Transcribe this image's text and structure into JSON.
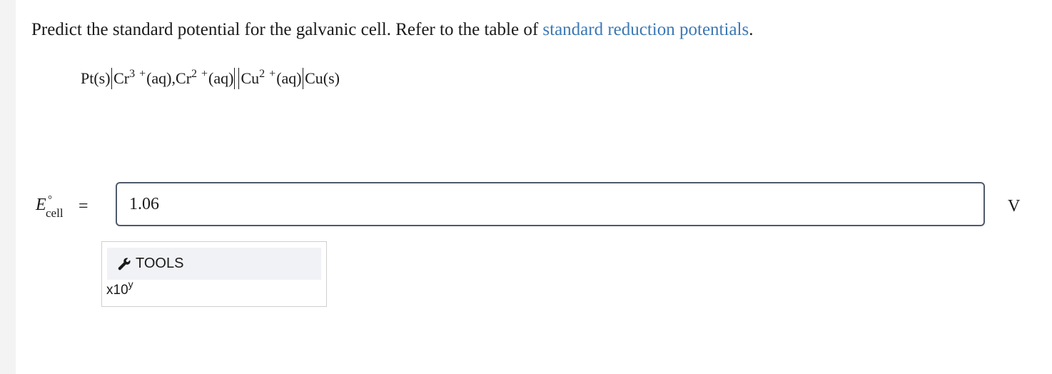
{
  "question": {
    "text": "Predict the standard potential for the galvanic cell. Refer to the table of ",
    "link_text": "standard reduction potentials",
    "end": "."
  },
  "cell": {
    "anode_electrode": "Pt(s)",
    "ion1": "Cr",
    "ion1_charge": "3 +",
    "ion1_state": "(aq), ",
    "ion2": "Cr",
    "ion2_charge": "2 +",
    "ion2_state": "(aq)",
    "ion3": "Cu",
    "ion3_charge": "2 +",
    "ion3_state": "(aq)",
    "cathode_electrode": "Cu(s)"
  },
  "answer": {
    "symbol": "E",
    "degree": "°",
    "subscript": "cell",
    "equals": "=",
    "value": "1.06",
    "unit": "V"
  },
  "tools": {
    "label": "TOOLS",
    "sci_base": "x10",
    "sci_exp": "y"
  },
  "colors": {
    "link": "#3b78b4",
    "input_border": "#4f5a6b",
    "tools_bg": "#f1f2f6"
  }
}
